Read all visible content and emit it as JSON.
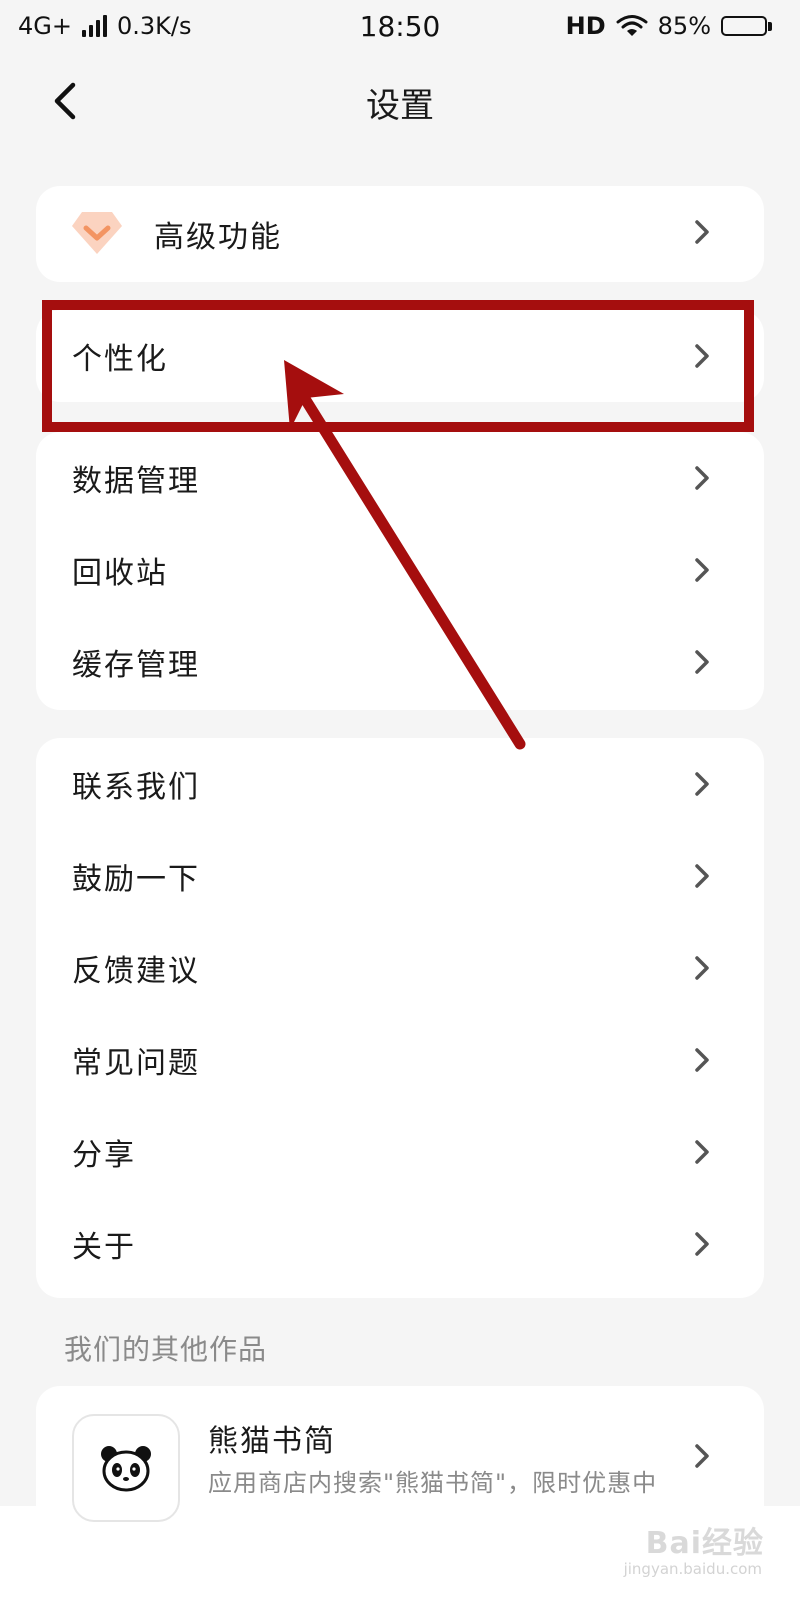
{
  "status_bar": {
    "network": "4G+",
    "speed": "0.3K/s",
    "time": "18:50",
    "hd": "HD",
    "battery": "85%",
    "battery_level": 0.85
  },
  "header": {
    "title": "设置",
    "back_icon": "chevron-left-icon"
  },
  "premium": {
    "label": "高级功能",
    "icon": "diamond-icon",
    "icon_color": "#f7b08f"
  },
  "personalize": {
    "label": "个性化"
  },
  "data_group": {
    "items": [
      {
        "label": "数据管理"
      },
      {
        "label": "回收站"
      },
      {
        "label": "缓存管理"
      }
    ]
  },
  "support_group": {
    "items": [
      {
        "label": "联系我们"
      },
      {
        "label": "鼓励一下"
      },
      {
        "label": "反馈建议"
      },
      {
        "label": "常见问题"
      },
      {
        "label": "分享"
      },
      {
        "label": "关于"
      }
    ]
  },
  "other_works": {
    "title": "我们的其他作品",
    "app": {
      "name": "熊猫书简",
      "description": "应用商店内搜索\"熊猫书简\"，限时优惠中",
      "icon": "panda-icon"
    }
  },
  "watermark": {
    "brand": "Bai经验",
    "url": "jingyan.baidu.com"
  },
  "annotation": {
    "color": "#a50e0e"
  }
}
